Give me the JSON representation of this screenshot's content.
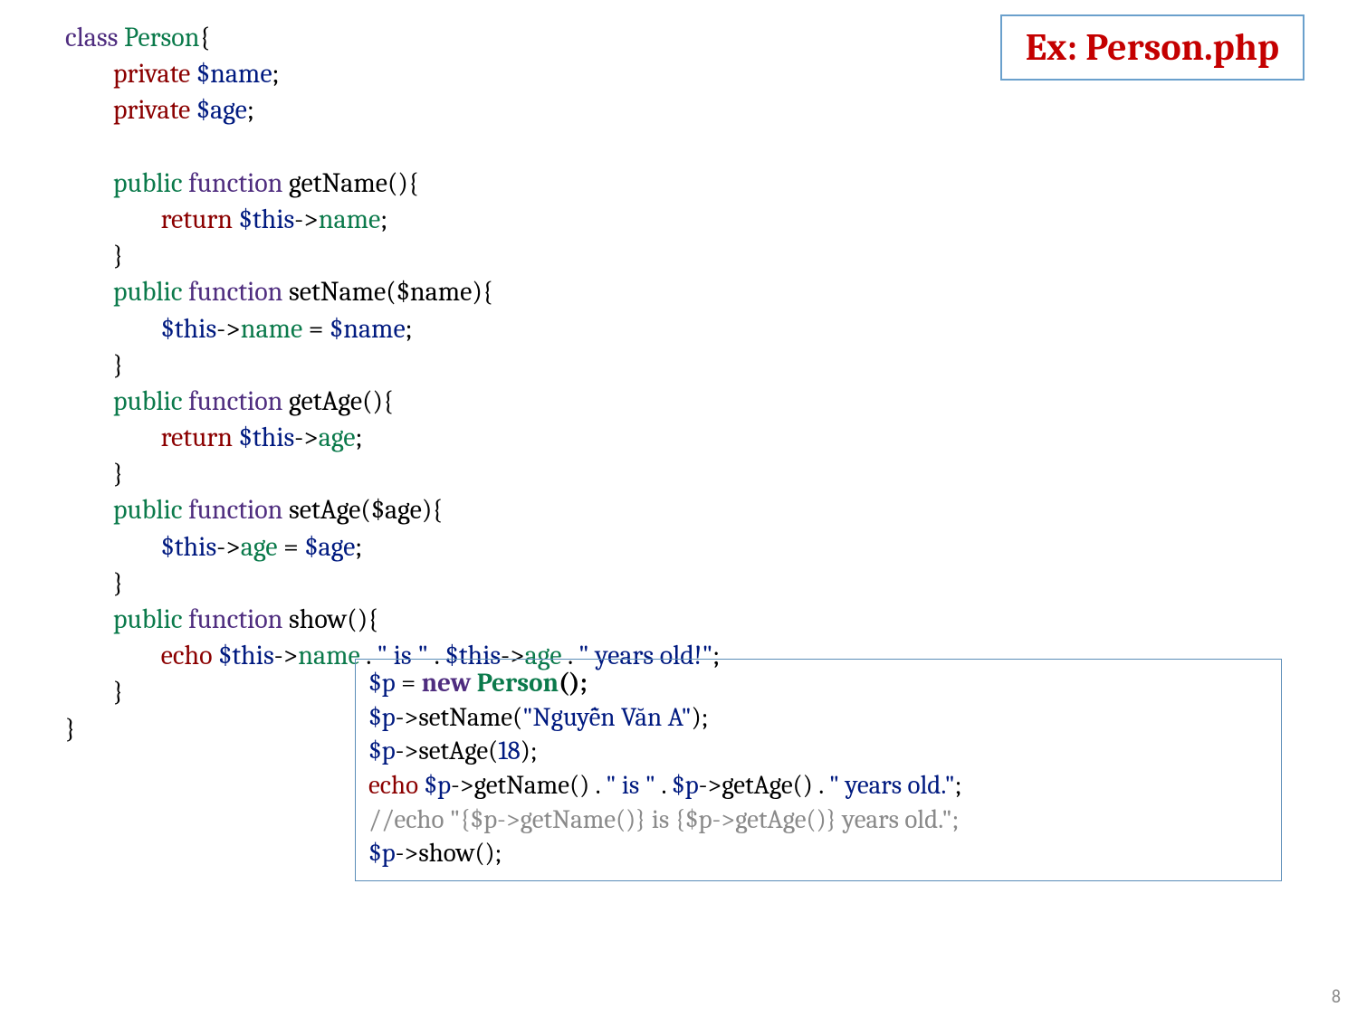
{
  "title_box": "Ex: Person.php",
  "page_number": "8",
  "code": {
    "class_kw": "class",
    "class_name": "Person",
    "brace_open": "{",
    "brace_close": "}",
    "private_kw": "private",
    "name_var": "$name",
    "age_var": "$age",
    "semi": ";",
    "public_kw": "public",
    "function_kw": "function",
    "fn_getName": "getName",
    "fn_setName": "setName",
    "fn_getAge": "getAge",
    "fn_setAge": "setAge",
    "fn_show": "show",
    "parens_empty": "()",
    "param_name": "($name)",
    "param_age": "($age)",
    "return_kw": "return",
    "this_kw": "$this",
    "arrow": "->",
    "prop_name": "name",
    "prop_age": "age",
    "echo_kw": "echo",
    "assign": " = ",
    "dot": " . ",
    "str_is": "\" is \"",
    "str_years_old_excl": "\" years old!\""
  },
  "snippet": {
    "p_var": "$p",
    "assign": " = ",
    "new_kw": "new",
    "person_cls": "Person",
    "parens_semi": "();",
    "arrow": "->",
    "setName": "setName",
    "setAge": "setAge",
    "getName": "getName",
    "getAge": "getAge",
    "show": "show",
    "str_name_arg": "\"Nguyễn Văn A\"",
    "num_age_arg": "18",
    "echo_kw": "echo",
    "dot": " . ",
    "str_is": "\" is \"",
    "str_years_old_dot": "\" years old.\"",
    "comment_line": "//echo \"{$p->getName()} is {$p->getAge()} years old.\";",
    "open_paren": "(",
    "close_paren_semi": ");",
    "close_paren": ")",
    "call_empty": "()",
    "semi": ";"
  }
}
